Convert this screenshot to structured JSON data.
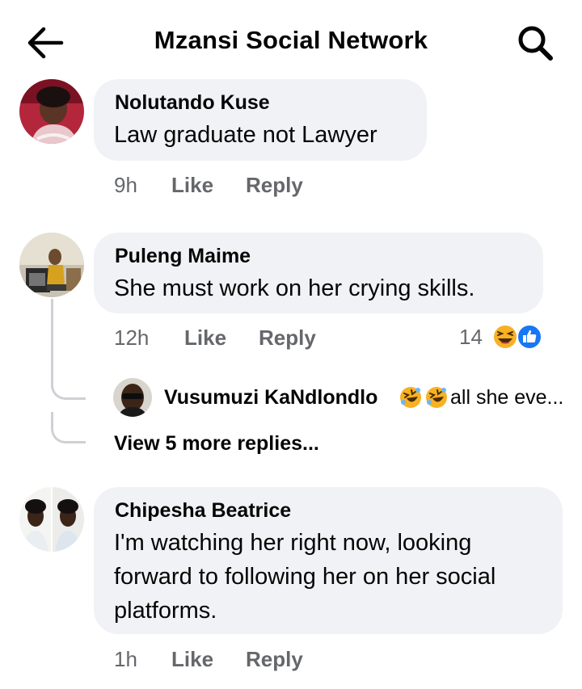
{
  "header": {
    "title": "Mzansi Social Network",
    "back_icon": "back-arrow-icon",
    "search_icon": "search-icon"
  },
  "comments": [
    {
      "name": "Nolutando Kuse",
      "text": "Law graduate not Lawyer",
      "time": "9h",
      "like_label": "Like",
      "reply_label": "Reply"
    },
    {
      "name": "Puleng Maime",
      "text": "She must work on her crying skills.",
      "time": "12h",
      "like_label": "Like",
      "reply_label": "Reply",
      "reaction_count": "14",
      "reaction_icons": [
        "laughing-emoji-icon",
        "like-reaction-icon"
      ],
      "reply_preview": {
        "name": "Vusumuzi KaNdlondlo",
        "text": "all she eve...",
        "emoji_icons": [
          "rolling-laughing-emoji-icon",
          "rolling-laughing-emoji-icon"
        ]
      },
      "view_more_label": "View 5 more replies..."
    },
    {
      "name": "Chipesha Beatrice",
      "text_lines": [
        "I'm watching her right now, looking",
        "forward to following her on her social",
        "platforms."
      ],
      "time": "1h",
      "like_label": "Like",
      "reply_label": "Reply"
    }
  ],
  "colors": {
    "bubble": "#f0f2f5",
    "meta_text": "#65676b",
    "like_blue": "#1877f2",
    "emoji_yellow": "#f7b125",
    "thread_line": "#ced0d4"
  }
}
